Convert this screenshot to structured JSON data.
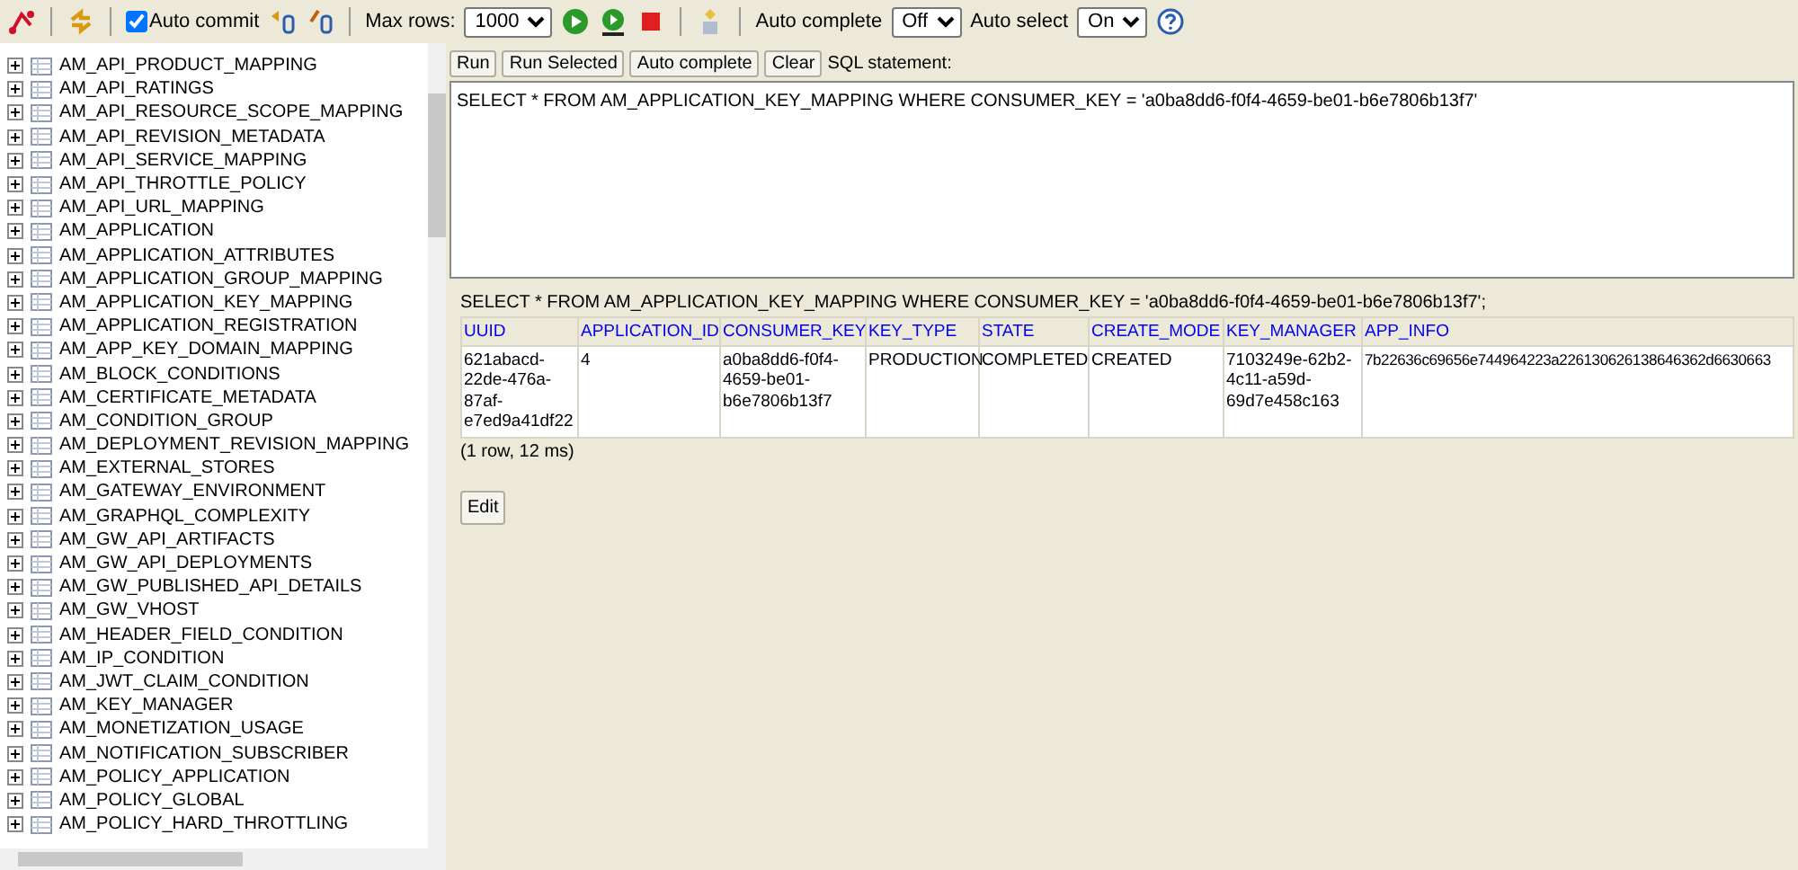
{
  "toolbar": {
    "auto_commit": {
      "label": "Auto commit",
      "checked": true
    },
    "max_rows": {
      "label": "Max rows:",
      "value": "1000"
    },
    "auto_complete": {
      "label": "Auto complete",
      "value": "Off"
    },
    "auto_select": {
      "label": "Auto select",
      "value": "On"
    }
  },
  "tree": {
    "items": [
      {
        "label": "AM_API_PRODUCT_MAPPING",
        "expanded": false
      },
      {
        "label": "AM_API_RATINGS",
        "expanded": false
      },
      {
        "label": "AM_API_RESOURCE_SCOPE_MAPPING",
        "expanded": false
      },
      {
        "label": "AM_API_REVISION_METADATA",
        "expanded": false
      },
      {
        "label": "AM_API_SERVICE_MAPPING",
        "expanded": false
      },
      {
        "label": "AM_API_THROTTLE_POLICY",
        "expanded": false
      },
      {
        "label": "AM_API_URL_MAPPING",
        "expanded": false
      },
      {
        "label": "AM_APPLICATION",
        "expanded": false
      },
      {
        "label": "AM_APPLICATION_ATTRIBUTES",
        "expanded": false
      },
      {
        "label": "AM_APPLICATION_GROUP_MAPPING",
        "expanded": false
      },
      {
        "label": "AM_APPLICATION_KEY_MAPPING",
        "expanded": false
      },
      {
        "label": "AM_APPLICATION_REGISTRATION",
        "expanded": false
      },
      {
        "label": "AM_APP_KEY_DOMAIN_MAPPING",
        "expanded": false
      },
      {
        "label": "AM_BLOCK_CONDITIONS",
        "expanded": false
      },
      {
        "label": "AM_CERTIFICATE_METADATA",
        "expanded": false
      },
      {
        "label": "AM_CONDITION_GROUP",
        "expanded": false
      },
      {
        "label": "AM_DEPLOYMENT_REVISION_MAPPING",
        "expanded": false
      },
      {
        "label": "AM_EXTERNAL_STORES",
        "expanded": false
      },
      {
        "label": "AM_GATEWAY_ENVIRONMENT",
        "expanded": false
      },
      {
        "label": "AM_GRAPHQL_COMPLEXITY",
        "expanded": false
      },
      {
        "label": "AM_GW_API_ARTIFACTS",
        "expanded": false
      },
      {
        "label": "AM_GW_API_DEPLOYMENTS",
        "expanded": false
      },
      {
        "label": "AM_GW_PUBLISHED_API_DETAILS",
        "expanded": false
      },
      {
        "label": "AM_GW_VHOST",
        "expanded": false
      },
      {
        "label": "AM_HEADER_FIELD_CONDITION",
        "expanded": false
      },
      {
        "label": "AM_IP_CONDITION",
        "expanded": false
      },
      {
        "label": "AM_JWT_CLAIM_CONDITION",
        "expanded": false
      },
      {
        "label": "AM_KEY_MANAGER",
        "expanded": false
      },
      {
        "label": "AM_MONETIZATION_USAGE",
        "expanded": false
      },
      {
        "label": "AM_NOTIFICATION_SUBSCRIBER",
        "expanded": false
      },
      {
        "label": "AM_POLICY_APPLICATION",
        "expanded": false
      },
      {
        "label": "AM_POLICY_GLOBAL",
        "expanded": false
      },
      {
        "label": "AM_POLICY_HARD_THROTTLING",
        "expanded": false
      }
    ]
  },
  "query_buttons": [
    "Run",
    "Run Selected",
    "Auto complete",
    "Clear"
  ],
  "sql_label": "SQL statement:",
  "sql_text": "SELECT * FROM AM_APPLICATION_KEY_MAPPING WHERE CONSUMER_KEY = 'a0ba8dd6-f0f4-4659-be01-b6e7806b13f7'",
  "result": {
    "query": "SELECT * FROM AM_APPLICATION_KEY_MAPPING WHERE CONSUMER_KEY = 'a0ba8dd6-f0f4-4659-be01-b6e7806b13f7';",
    "columns": [
      "UUID",
      "APPLICATION_ID",
      "CONSUMER_KEY",
      "KEY_TYPE",
      "STATE",
      "CREATE_MODE",
      "KEY_MANAGER",
      "APP_INFO"
    ],
    "rows": [
      [
        "621abacd-22de-476a-87af-e7ed9a41df22",
        "4",
        "a0ba8dd6-f0f4-4659-be01-b6e7806b13f7",
        "PRODUCTION",
        "COMPLETED",
        "CREATED",
        "7103249e-62b2-4c11-a59d-69d7e458c163",
        "7b22636c69656e744964223a226130626138646362d6630663"
      ]
    ],
    "footer": "(1 row, 12 ms)",
    "edit_button": "Edit"
  }
}
